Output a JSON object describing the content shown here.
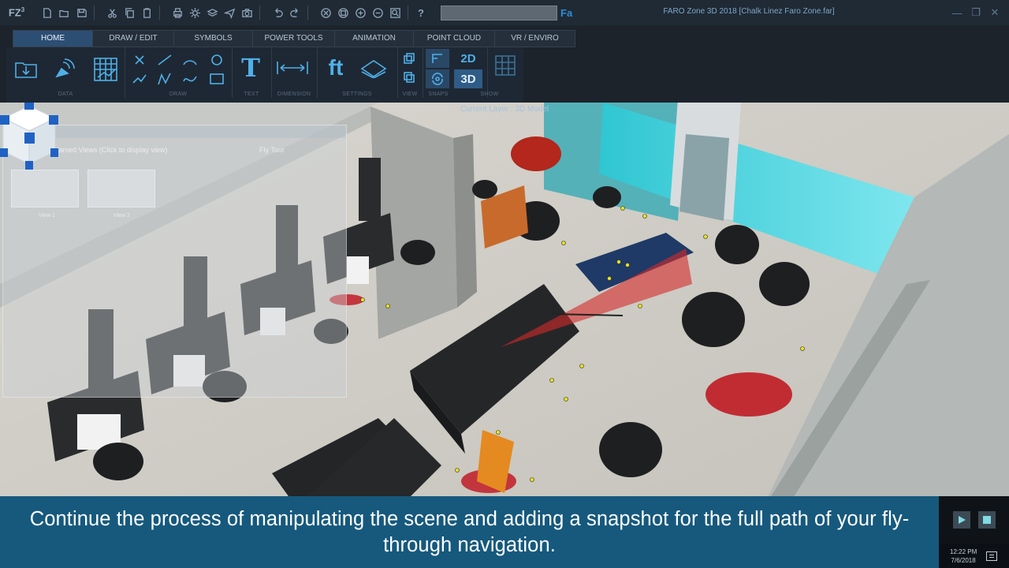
{
  "app": {
    "logo": "FZ",
    "logo_sup": "3",
    "window_title": "FARO Zone 3D 2018 [Chalk Linez Faro Zone.far]",
    "search_button": "Fa"
  },
  "ribbon": {
    "tabs": [
      {
        "label": "HOME",
        "active": true
      },
      {
        "label": "DRAW / EDIT",
        "active": false
      },
      {
        "label": "SYMBOLS",
        "active": false
      },
      {
        "label": "POWER TOOLS",
        "active": false
      },
      {
        "label": "ANIMATION",
        "active": false
      },
      {
        "label": "POINT CLOUD",
        "active": false
      },
      {
        "label": "VR / ENVIRO",
        "active": false
      }
    ],
    "groups": [
      "DATA",
      "DRAW",
      "TEXT",
      "DIMENSION",
      "SETTINGS",
      "VIEW",
      "SNAPS",
      "SHOW"
    ],
    "text_tool": "T",
    "settings_tool": "ft",
    "view_2d": "2D",
    "view_3d": "3D",
    "current_layer": "Current Layer : 3D Model"
  },
  "named_views": {
    "title": "Fly Tour",
    "tab_label": "Named Views (Click to display view)",
    "second_tab": "Fly Tour",
    "thumbs": [
      "View 1",
      "View 2"
    ]
  },
  "caption": "Continue the process of manipulating the scene and adding a snapshot for the full path of your fly-through navigation.",
  "tray": {
    "time": "12:22 PM",
    "date": "7/6/2018"
  },
  "colors": {
    "accent": "#4fb0e8",
    "caption_bg": "#16597d",
    "title_bg": "#1f2a35"
  }
}
